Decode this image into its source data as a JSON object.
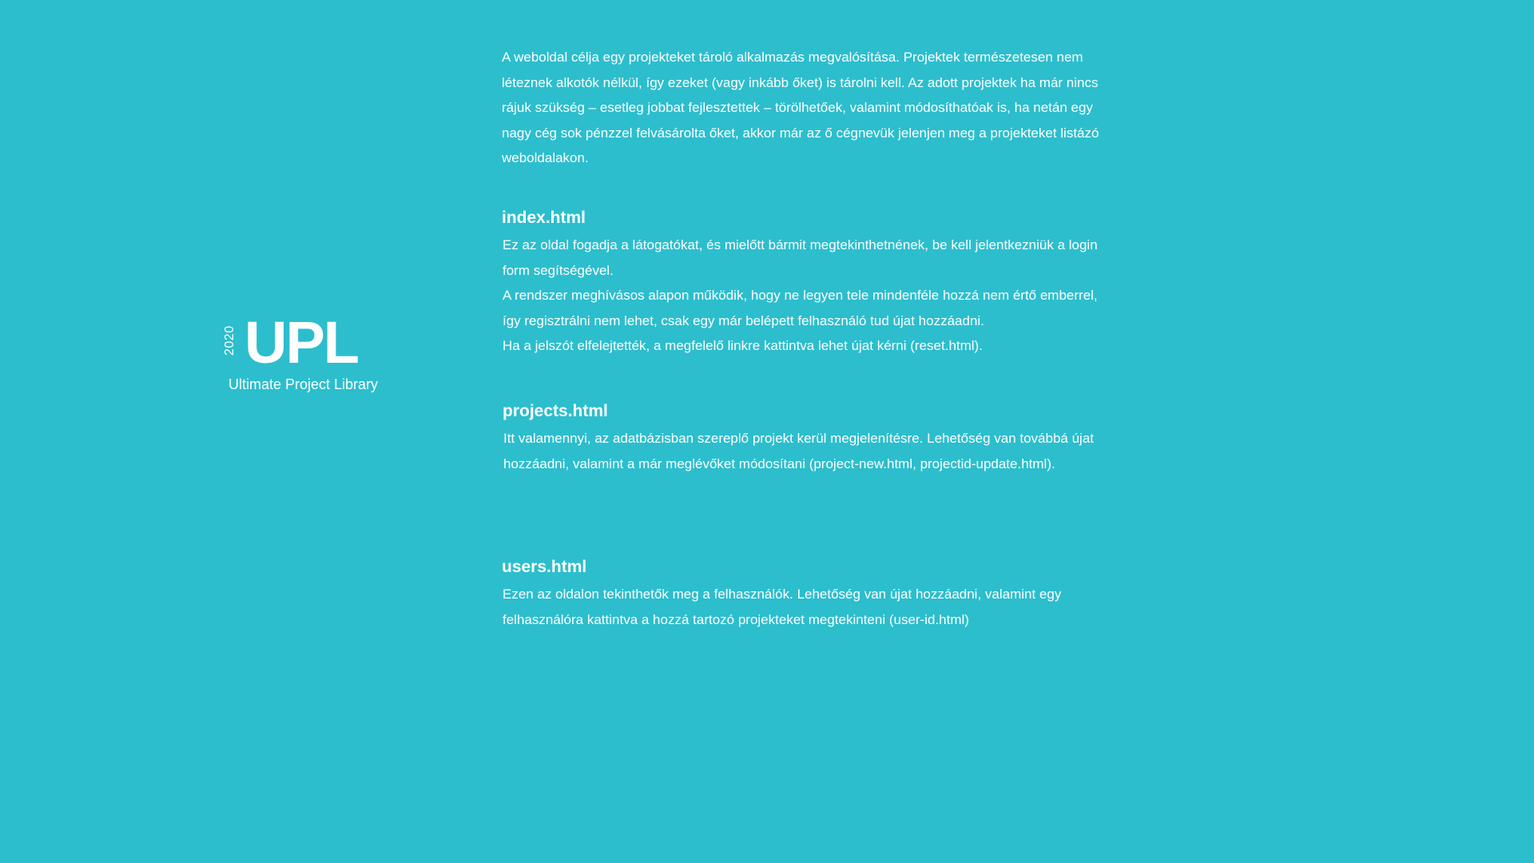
{
  "brand": {
    "year": "2020",
    "logo": "UPL",
    "subtitle": "Ultimate Project Library"
  },
  "intro": "A weboldal célja egy projekteket tároló alkalmazás megvalósítása. Projektek természetesen nem léteznek alkotók nélkül, így ezeket (vagy inkább őket) is tárolni kell. Az adott projektek ha már nincs rájuk szükség – esetleg jobbat fejlesztettek – törölhetőek, valamint módosíthatóak is, ha netán egy nagy cég sok pénzzel felvásárolta őket, akkor már az ő cégnevük jelenjen meg a projekteket listázó weboldalakon.",
  "sections": [
    {
      "title": "index.html",
      "paragraphs": [
        "Ez az oldal fogadja a látogatókat, és mielőtt bármit megtekinthetnének, be kell jelentkezniük a login form segítségével.",
        "A rendszer meghívásos alapon működik, hogy ne legyen tele mindenféle hozzá nem értő emberrel, így regisztrálni nem lehet, csak egy már belépett felhasználó tud újat hozzáadni.",
        "Ha a jelszót elfelejtették, a megfelelő linkre kattintva lehet újat kérni (reset.html)."
      ]
    },
    {
      "title": "projects.html",
      "paragraphs": [
        "Itt valamennyi, az adatbázisban szereplő projekt kerül megjelenítésre. Lehetőség van továbbá újat hozzáadni, valamint a már meglévőket módosítani (project-new.html, projectid-update.html)."
      ]
    },
    {
      "title": "users.html",
      "paragraphs": [
        "Ezen az oldalon tekinthetők meg a felhasználók. Lehetőség van újat hozzáadni, valamint egy felhasználóra kattintva a hozzá tartozó projekteket megtekinteni (user-id.html)"
      ]
    }
  ]
}
